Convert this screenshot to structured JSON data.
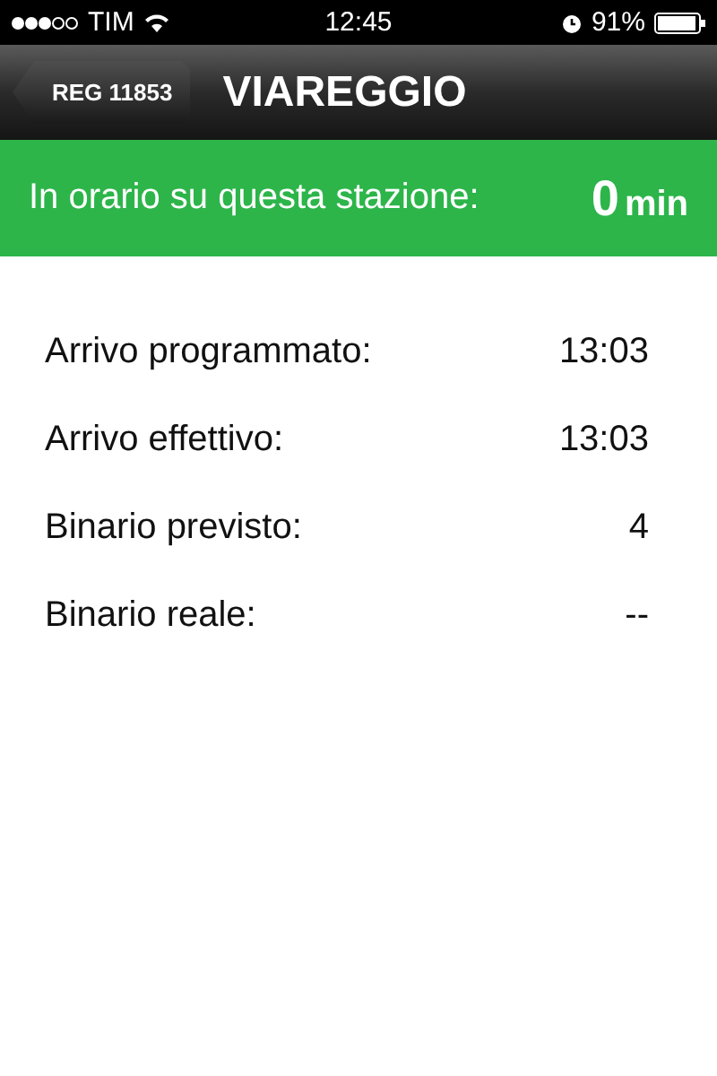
{
  "status_bar": {
    "carrier": "TIM",
    "time": "12:45",
    "battery": "91%"
  },
  "nav_bar": {
    "back_button": "REG 11853",
    "title": "VIAREGGIO"
  },
  "banner": {
    "label": "In orario su questa stazione:",
    "value": "0",
    "unit": "min"
  },
  "details": [
    {
      "label": "Arrivo programmato:",
      "value": "13:03"
    },
    {
      "label": "Arrivo effettivo:",
      "value": "13:03"
    },
    {
      "label": "Binario previsto:",
      "value": "4"
    },
    {
      "label": "Binario reale:",
      "value": "--"
    }
  ]
}
